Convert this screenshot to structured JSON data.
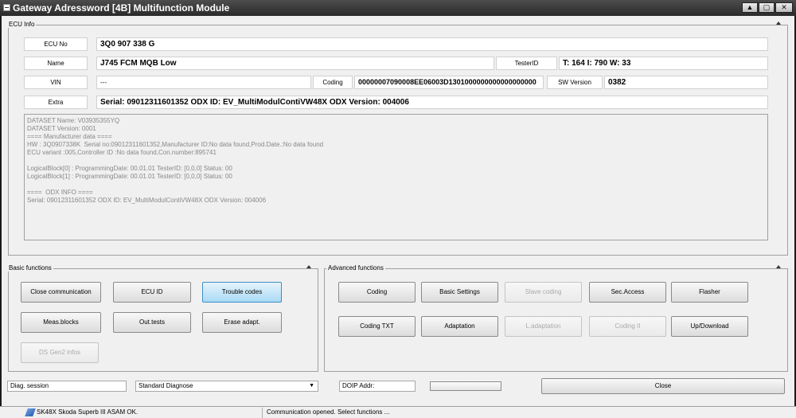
{
  "window": {
    "title": "Gateway Adressword [4B] Multifunction Module"
  },
  "ecu_info": {
    "legend": "ECU Info",
    "ecu_no_label": "ECU No",
    "ecu_no": "3Q0 907 338 G",
    "name_label": "Name",
    "name": "J745  FCM MQB Low",
    "tester_id_label": "TesterID",
    "tester_id": "T: 164 I: 790 W: 33",
    "vin_label": "VIN",
    "vin": "---",
    "coding_label": "Coding",
    "coding": "00000007090008EE06003D1301000000000000000000",
    "sw_version_label": "SW Version",
    "sw_version": "0382",
    "extra_label": "Extra",
    "extra": "Serial: 09012311601352 ODX ID: EV_MultiModulContiVW48X ODX Version: 004006",
    "details": "DATASET Name: V03935355YQ\nDATASET Version: 0001\n==== Manufacturer data ====\nHW : 3Q0907338K  Serial no:09012311601352,Manufacturer ID:No data found,Prod.Date.:No data found\nECU variant :005,Controller ID :No data found,Con.number:895741\n\nLogicalBlock[0] : ProgrammingDate: 00.01.01 TesterID: [0,0,0] Status: 00\nLogicalBlock[1] : ProgrammingDate: 00.01.01 TesterID: [0,0,0] Status: 00\n\n====  ODX INFO ====\nSerial: 09012311601352 ODX ID: EV_MultiModulContiVW48X ODX Version: 004006"
  },
  "basic": {
    "legend": "Basic functions",
    "close_communication": "Close communication",
    "ecu_id": "ECU ID",
    "trouble_codes": "Trouble codes",
    "meas_blocks": "Meas.blocks",
    "out_tests": "Out.tests",
    "erase_adapt": "Erase adapt.",
    "ds_gen2": "DS Gen2 infos"
  },
  "advanced": {
    "legend": "Advanced functions",
    "coding": "Coding",
    "basic_settings": "Basic Settings",
    "slave_coding": "Slave coding",
    "sec_access": "Sec.Access",
    "flasher": "Flasher",
    "coding_txt": "Coding TXT",
    "adaptation": "Adaptation",
    "l_adaptation": "L.adaptation",
    "coding_ii": "Coding II",
    "up_download": "Up/Download"
  },
  "bottom": {
    "diag_session_label": "Diag. session",
    "diag_session_value": "Standard Diagnose",
    "doip_label": "DOIP Addr:",
    "close": "Close"
  },
  "status": {
    "vehicle": "SK48X Skoda Superb III ASAM OK.",
    "message": "Communication opened. Select functions ..."
  }
}
